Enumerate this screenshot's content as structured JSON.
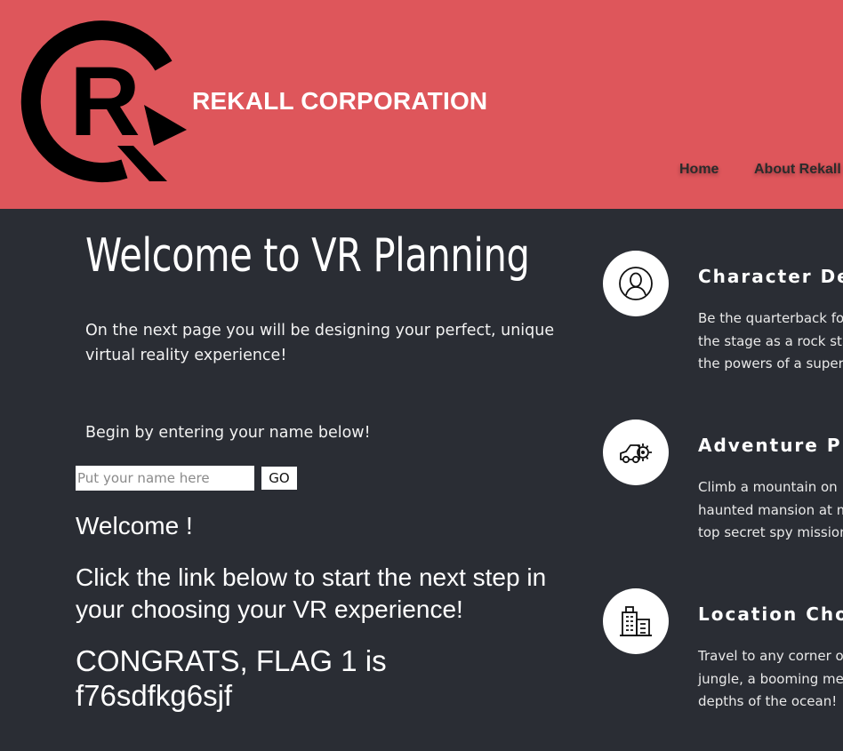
{
  "header": {
    "brand": "REKALL CORPORATION",
    "bg_color": "#de565b",
    "logo_letter": "R",
    "nav": [
      {
        "label": "Home"
      },
      {
        "label": "About Rekall"
      }
    ]
  },
  "main": {
    "title": "Welcome to VR Planning",
    "intro": "On the next  page you will be designing your perfect, unique virtual reality experience!",
    "begin": "Begin by entering your name below!",
    "name_input": {
      "value": "",
      "placeholder": "Put your name here"
    },
    "go_label": "GO",
    "welcome": "Welcome !",
    "click_msg": "Click the link below to start the next step in your choosing your VR experience!",
    "flag_msg": "CONGRATS, FLAG 1 is f76sdfkg6sjf"
  },
  "features": [
    {
      "title": "Character Dev",
      "icon": "user-icon",
      "desc_lines": [
        "Be the quarterback fo",
        "the stage as a rock sta",
        "the powers of a super"
      ]
    },
    {
      "title": "Adventure Pla",
      "icon": "car-gear-icon",
      "desc_lines": [
        "Climb a mountain on",
        "haunted mansion at m",
        "top secret spy mission"
      ]
    },
    {
      "title": "Location Choi",
      "icon": "buildings-icon",
      "desc_lines": [
        "Travel to any corner o",
        "jungle, a booming met",
        "depths of the ocean!"
      ]
    }
  ],
  "colors": {
    "page_bg": "#2a2d34",
    "header_bg": "#de565b",
    "text": "#ffffff"
  }
}
